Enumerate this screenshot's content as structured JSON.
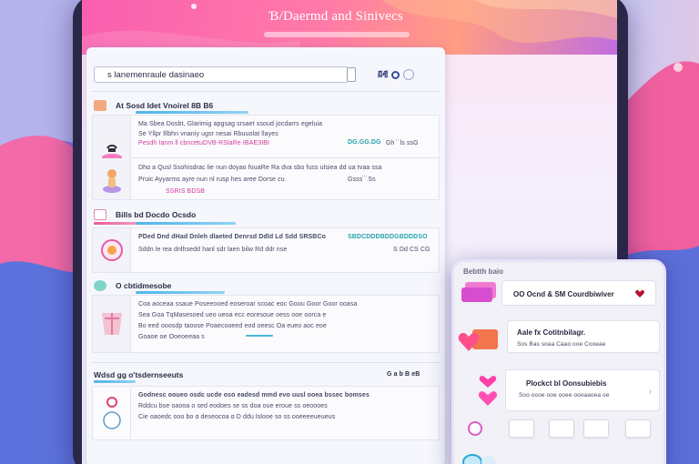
{
  "app": {
    "title": "Ɓ/Daermd and Sinivecs"
  },
  "search": {
    "value": "s lanemenraule dasinaeo",
    "tools_label": "ผีซี"
  },
  "sections": [
    {
      "heading": "At Sosd Idet Vnoirel  8B B6",
      "rows": [
        {
          "line1": "Ma Sbea Dosbt, Glarimig  apgsag srsaet ssoud jocdarrs egeluia",
          "line2": "Se Yllpr lllbhn vnaniy   ugsr nesai Rbuuolat llayes",
          "line3": "Pesdh Ianm ll  cbncetuDVB-RSlaRe  IBAE3IBI",
          "badge": "DG.GG.DG",
          "trail": "Gh ꙶ ꙶ ls ssG"
        },
        {
          "line1": "Dhɑ a   Qusl  Ssohisdrac lie nun  doyao fouaRe  Ra  dva sbo  fuss  ulsiea  dd ua  tvaa  ssa",
          "line2": "Pruic  Ayyarms  ayre  nun  nl  rusp  hes  aree  Dorse  cu",
          "line3": "SSRIS  BDSB",
          "trail": "Gsssꙶ  ꙶ ꙶ Ss"
        }
      ]
    },
    {
      "heading": "Bills  bd  Docdo  Ocsdo",
      "rows": [
        {
          "line1": "PDed Dnd dHad Dnleh  dlaeted  Denrsd  Ddld  Ld  Sdd  SRSBCo",
          "line2": "Sddn le rea dnlhsedd hanl   sdr   laen  bilw  Rd  ddr    nse",
          "badge": "SBDCDDDBDDGBDDDSO",
          "trail": "S  Dd  CS  CG"
        }
      ]
    },
    {
      "heading": "O  cbtidmesobe",
      "rows": [
        {
          "line1": "Coa aoceaa ssaue  Poseeooed  eoseroar  scoac  eoc  Goou  Goor  Goor  ooasa",
          "line2": "Sea  Goa  TqMasesoed  ueo  ueoa  ecc  eoresoue  oess  ooe  oorca  e",
          "line3": "Bo  eed   ooosdp  taoose  Poaecooeed  eod  oeesc  Oa  eueo  aoc  eoe",
          "line4": "Goaoe  oe   Ooeoeeaa  s"
        }
      ]
    },
    {
      "heading": "Wdsd  gg  o'tsdernseeuts",
      "meta": "G a b  B eB",
      "rows": [
        {
          "line1": "Godnesc  ooueo  osdc  ucde  oso  eadesd  mmd  evo  uusl   ooea   bssec  bomses",
          "line2": "Rddcu  bse  oaooa   o  sed    eodoes  se  ss  doa  oue  eroue  ss  oeoooes",
          "line3": "Cie   oaoedc    ooo  bo  ɑ   deseocoa  ɑ   D  ddu   lslooe   so  ss   ooeeeeueueus"
        }
      ]
    }
  ],
  "phone": {
    "label": "Bebtth baio",
    "cards": [
      {
        "title": "OO  Ocnd & SM  Courdbiwiver",
        "sub": ""
      },
      {
        "title": "Aale  fx  Cotitnbilagr.",
        "sub": "Sos  Bas soaa  Caao ooe  Cooeae"
      },
      {
        "title": "Plockct  bl  Oonsubiebis",
        "sub": "Soo  oooe  ooe  ooee  oooaaoea  oe"
      }
    ]
  },
  "colors": {
    "accent_pink": "#f45ba8",
    "accent_blue": "#4fb4ea",
    "accent_teal": "#27a3a8",
    "heart_red": "#c9173a"
  }
}
